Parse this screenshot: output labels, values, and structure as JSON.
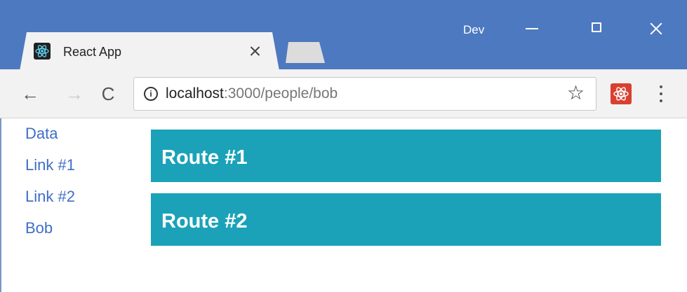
{
  "window": {
    "profile_name": "Dev"
  },
  "tab": {
    "title": "React App",
    "favicon": "react-icon"
  },
  "toolbar": {
    "back_icon": "←",
    "forward_icon": "→",
    "reload_icon": "C",
    "url_host": "localhost",
    "url_rest": ":3000/people/bob",
    "info_icon": "i",
    "star_icon": "☆"
  },
  "page": {
    "links": [
      {
        "label": "Data"
      },
      {
        "label": "Link #1"
      },
      {
        "label": "Link #2"
      },
      {
        "label": "Bob"
      }
    ],
    "routes": [
      {
        "title": "Route #1"
      },
      {
        "title": "Route #2"
      }
    ]
  },
  "colors": {
    "titlebar": "#4d79c0",
    "link": "#3f6fc5",
    "route_bg": "#1ba2b9"
  }
}
